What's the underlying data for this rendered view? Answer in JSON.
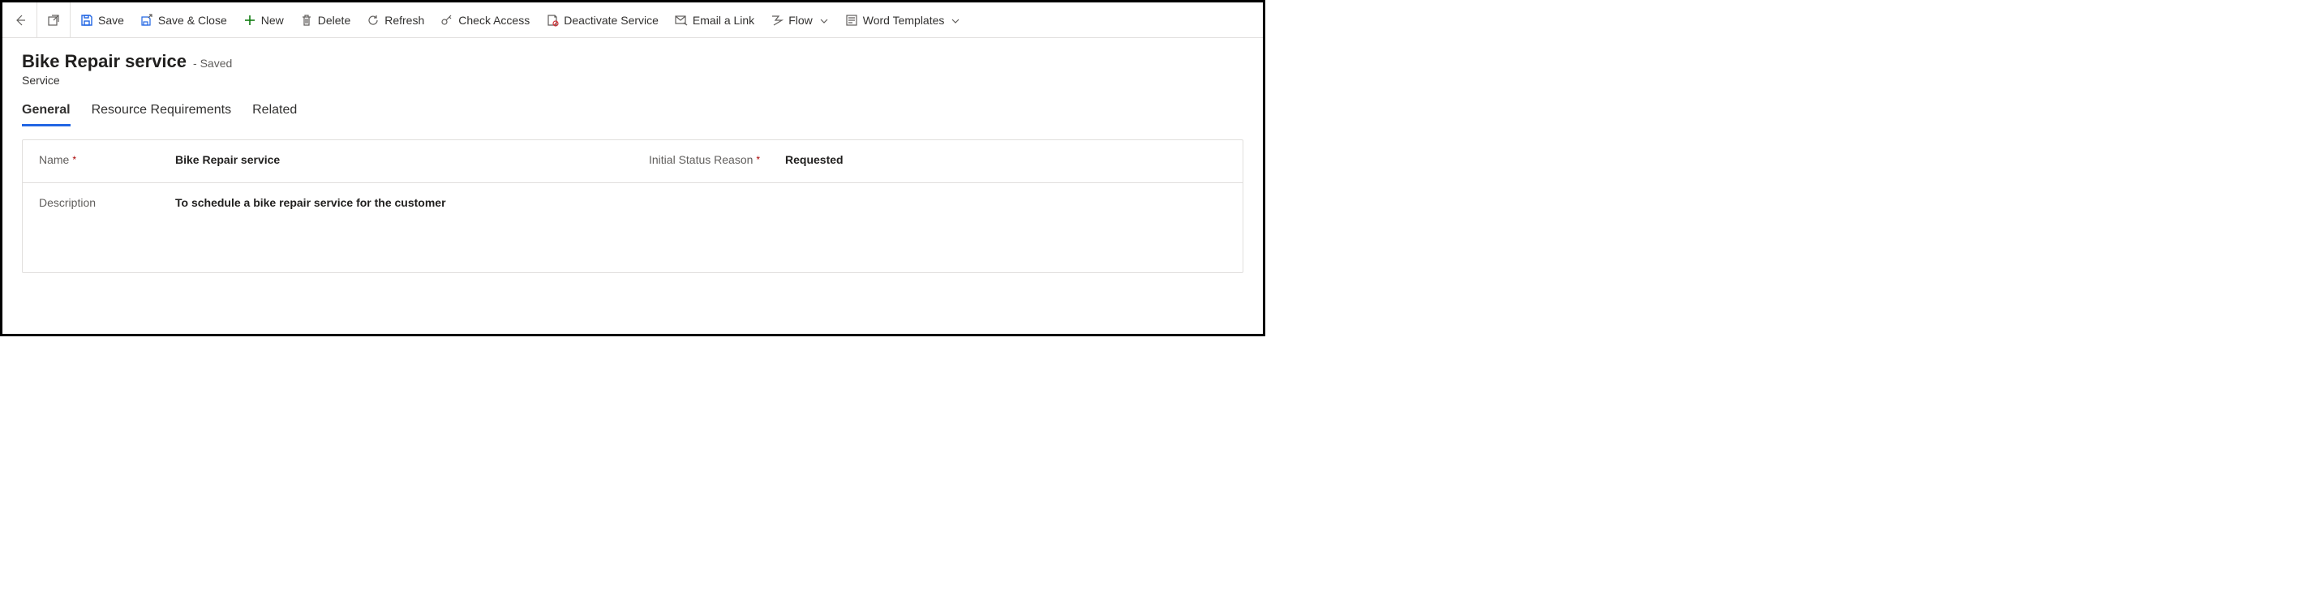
{
  "toolbar": {
    "save": "Save",
    "save_close": "Save & Close",
    "new": "New",
    "delete": "Delete",
    "refresh": "Refresh",
    "check_access": "Check Access",
    "deactivate": "Deactivate Service",
    "email_link": "Email a Link",
    "flow": "Flow",
    "word_templates": "Word Templates"
  },
  "header": {
    "title": "Bike Repair service",
    "saved_suffix": "- Saved",
    "entity": "Service"
  },
  "tabs": {
    "general": "General",
    "resource_requirements": "Resource Requirements",
    "related": "Related"
  },
  "form": {
    "name_label": "Name",
    "name_value": "Bike Repair service",
    "status_label": "Initial Status Reason",
    "status_value": "Requested",
    "description_label": "Description",
    "description_value": "To schedule a bike repair service for the customer"
  }
}
